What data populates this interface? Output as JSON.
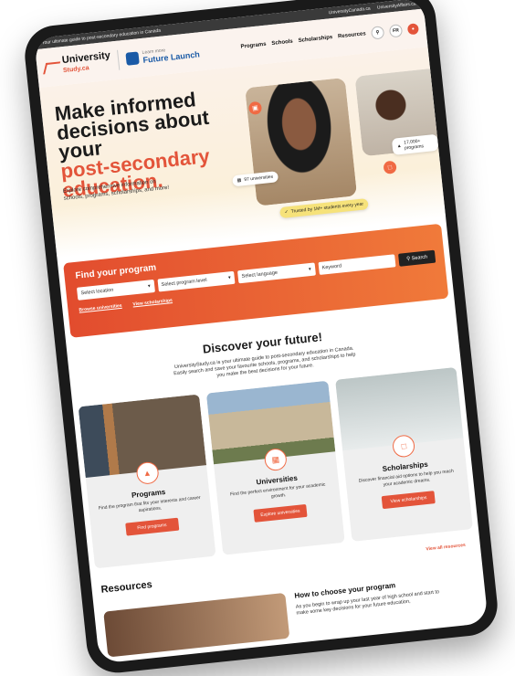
{
  "topbar": {
    "tagline": "Your ultimate guide to post-secondary education in Canada",
    "links": [
      "UniversityCanada.ca",
      "UniversityAffairs.ca"
    ]
  },
  "header": {
    "logo_text": "University",
    "logo_suffix": "Study.ca",
    "partner_small": "Learn more",
    "partner_name": "Future Launch",
    "nav": [
      "Programs",
      "Schools",
      "Scholarships",
      "Resources"
    ],
    "lang": "FR"
  },
  "hero": {
    "title_line1": "Make informed",
    "title_line2": "decisions about your",
    "title_accent": "post-secondary",
    "title_line4": "education.",
    "description": "Explore comprehensive information on schools, programs, scholarships, and more!",
    "chip_universities": "97 universities",
    "chip_programs": "17,000+ programs",
    "chip_trusted": "Trusted by 1M+ students every year"
  },
  "finder": {
    "title": "Find your program",
    "location_placeholder": "Select location",
    "level_placeholder": "Select program level",
    "language_placeholder": "Select language",
    "keyword_placeholder": "Keyword",
    "search_label": "Search",
    "link_universities": "Browse universities",
    "link_scholarships": "View scholarships"
  },
  "discover": {
    "title": "Discover your future!",
    "description": "UniversityStudy.ca is your ultimate guide to post-secondary education in Canada. Easily search and save your favourite schools, programs, and scholarships to help you make the best decisions for your future."
  },
  "cards": [
    {
      "title": "Programs",
      "description": "Find the program that fits your interests and career aspirations.",
      "button": "Find programs"
    },
    {
      "title": "Universities",
      "description": "Find the perfect environment for your academic growth.",
      "button": "Explore universities"
    },
    {
      "title": "Scholarships",
      "description": "Discover financial aid options to help you reach your academic dreams.",
      "button": "View scholarships"
    }
  ],
  "resources": {
    "title": "Resources",
    "view_all": "View all resources",
    "article_title": "How to choose your program",
    "article_text": "As you begin to wrap up your last year of high school and start to make some key decisions for your future education,"
  }
}
